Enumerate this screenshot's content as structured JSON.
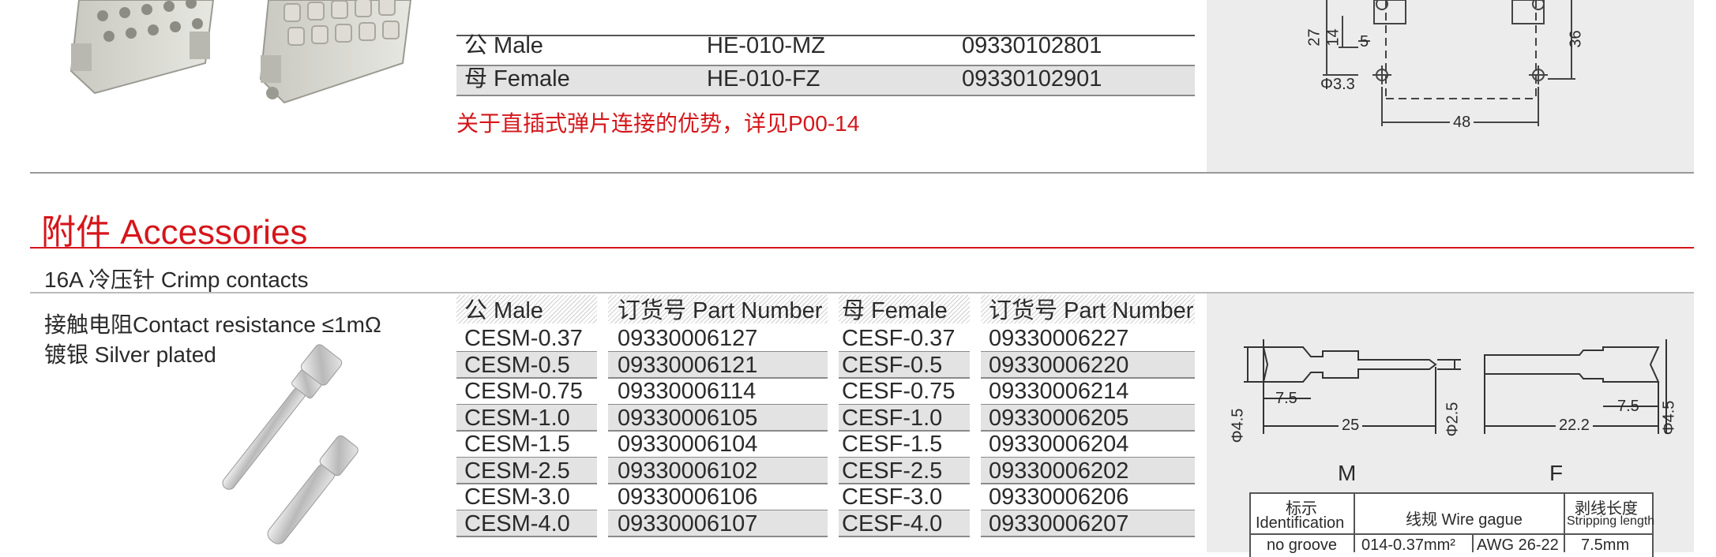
{
  "top_table": {
    "rows": [
      {
        "gender": "公 Male",
        "model": "HE-010-MZ",
        "part": "09330102801"
      },
      {
        "gender": "母 Female",
        "model": "HE-010-FZ",
        "part": "09330102901"
      }
    ],
    "note": "关于直插式弹片连接的优势，详见P00-14"
  },
  "top_drawing": {
    "dims": {
      "d27": "27",
      "d14": "14",
      "d5": "5",
      "d36": "36",
      "d48": "48",
      "hole": "Φ3.3"
    }
  },
  "accessories": {
    "title": "附件 Accessories",
    "subtitle": "16A 冷压针 Crimp contacts",
    "spec1": "接触电阻Contact resistance ≤1mΩ",
    "spec2": "镀银 Silver plated",
    "headers": [
      "公 Male",
      "订货号 Part Number",
      "母 Female",
      "订货号 Part Number"
    ],
    "rows": [
      [
        "CESM-0.37",
        "09330006127",
        "CESF-0.37",
        "09330006227"
      ],
      [
        "CESM-0.5",
        "09330006121",
        "CESF-0.5",
        "09330006220"
      ],
      [
        "CESM-0.75",
        "09330006114",
        "CESF-0.75",
        "09330006214"
      ],
      [
        "CESM-1.0",
        "09330006105",
        "CESF-1.0",
        "09330006205"
      ],
      [
        "CESM-1.5",
        "09330006104",
        "CESF-1.5",
        "09330006204"
      ],
      [
        "CESM-2.5",
        "09330006102",
        "CESF-2.5",
        "09330006202"
      ],
      [
        "CESM-3.0",
        "09330006106",
        "CESF-3.0",
        "09330006206"
      ],
      [
        "CESM-4.0",
        "09330006107",
        "CESF-4.0",
        "09330006207"
      ]
    ]
  },
  "contact_drawing": {
    "dims": {
      "d75a": "7.5",
      "d25": "25",
      "d25dia": "Φ2.5",
      "d45a": "Φ4.5",
      "d75b": "7.5",
      "d222": "22.2",
      "d45b": "Φ4.5"
    },
    "label_m": "M",
    "label_f": "F"
  },
  "wire_table": {
    "h1a": "标示",
    "h1b": "Identification",
    "h2": "线规 Wire gague",
    "h3a": "剥线长度",
    "h3b": "Stripping length",
    "r1": [
      "no groove",
      "014-0.37mm²",
      "AWG 26-22",
      "7.5mm"
    ]
  }
}
